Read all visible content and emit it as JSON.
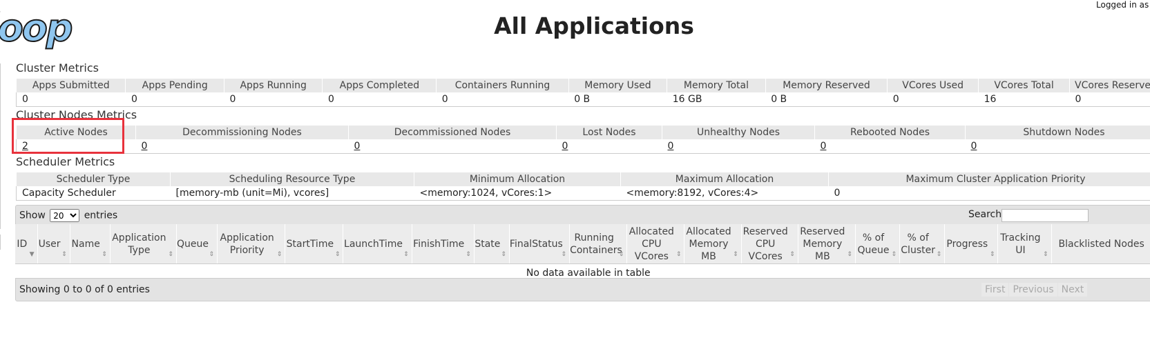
{
  "header": {
    "logo_text": "doop",
    "title": "All Applications",
    "logged_in": "Logged in as"
  },
  "cluster_metrics": {
    "title": "Cluster Metrics",
    "headers": [
      "Apps Submitted",
      "Apps Pending",
      "Apps Running",
      "Apps Completed",
      "Containers Running",
      "Memory Used",
      "Memory Total",
      "Memory Reserved",
      "VCores Used",
      "VCores Total",
      "VCores Reserved"
    ],
    "values": [
      "0",
      "0",
      "0",
      "0",
      "0",
      "0 B",
      "16 GB",
      "0 B",
      "0",
      "16",
      "0"
    ]
  },
  "cluster_nodes_metrics": {
    "title": "Cluster Nodes Metrics",
    "headers": [
      "Active Nodes",
      "Decommissioning Nodes",
      "Decommissioned Nodes",
      "Lost Nodes",
      "Unhealthy Nodes",
      "Rebooted Nodes",
      "Shutdown Nodes"
    ],
    "values": [
      "2",
      "0",
      "0",
      "0",
      "0",
      "0",
      "0"
    ]
  },
  "scheduler_metrics": {
    "title": "Scheduler Metrics",
    "headers": [
      "Scheduler Type",
      "Scheduling Resource Type",
      "Minimum Allocation",
      "Maximum Allocation",
      "Maximum Cluster Application Priority"
    ],
    "values": [
      "Capacity Scheduler",
      "[memory-mb (unit=Mi), vcores]",
      "<memory:1024, vCores:1>",
      "<memory:8192, vCores:4>",
      "0"
    ]
  },
  "table_controls": {
    "show_label": "Show",
    "entries_label": "entries",
    "page_size": "20",
    "search_label": "Search:",
    "search_value": ""
  },
  "apps_table": {
    "columns": [
      "ID",
      "User",
      "Name",
      "Application Type",
      "Queue",
      "Application Priority",
      "StartTime",
      "LaunchTime",
      "FinishTime",
      "State",
      "FinalStatus",
      "Running Containers",
      "Allocated CPU VCores",
      "Allocated Memory MB",
      "Reserved CPU VCores",
      "Reserved Memory MB",
      "% of Queue",
      "% of Cluster",
      "Progress",
      "Tracking UI",
      "Blacklisted Nodes"
    ],
    "empty_message": "No data available in table"
  },
  "footer": {
    "info": "Showing 0 to 0 of 0 entries",
    "pager": [
      "First",
      "Previous",
      "Next"
    ]
  },
  "annotation": {
    "highlight_color": "#e8323c",
    "highlight_target": "Active Nodes"
  }
}
